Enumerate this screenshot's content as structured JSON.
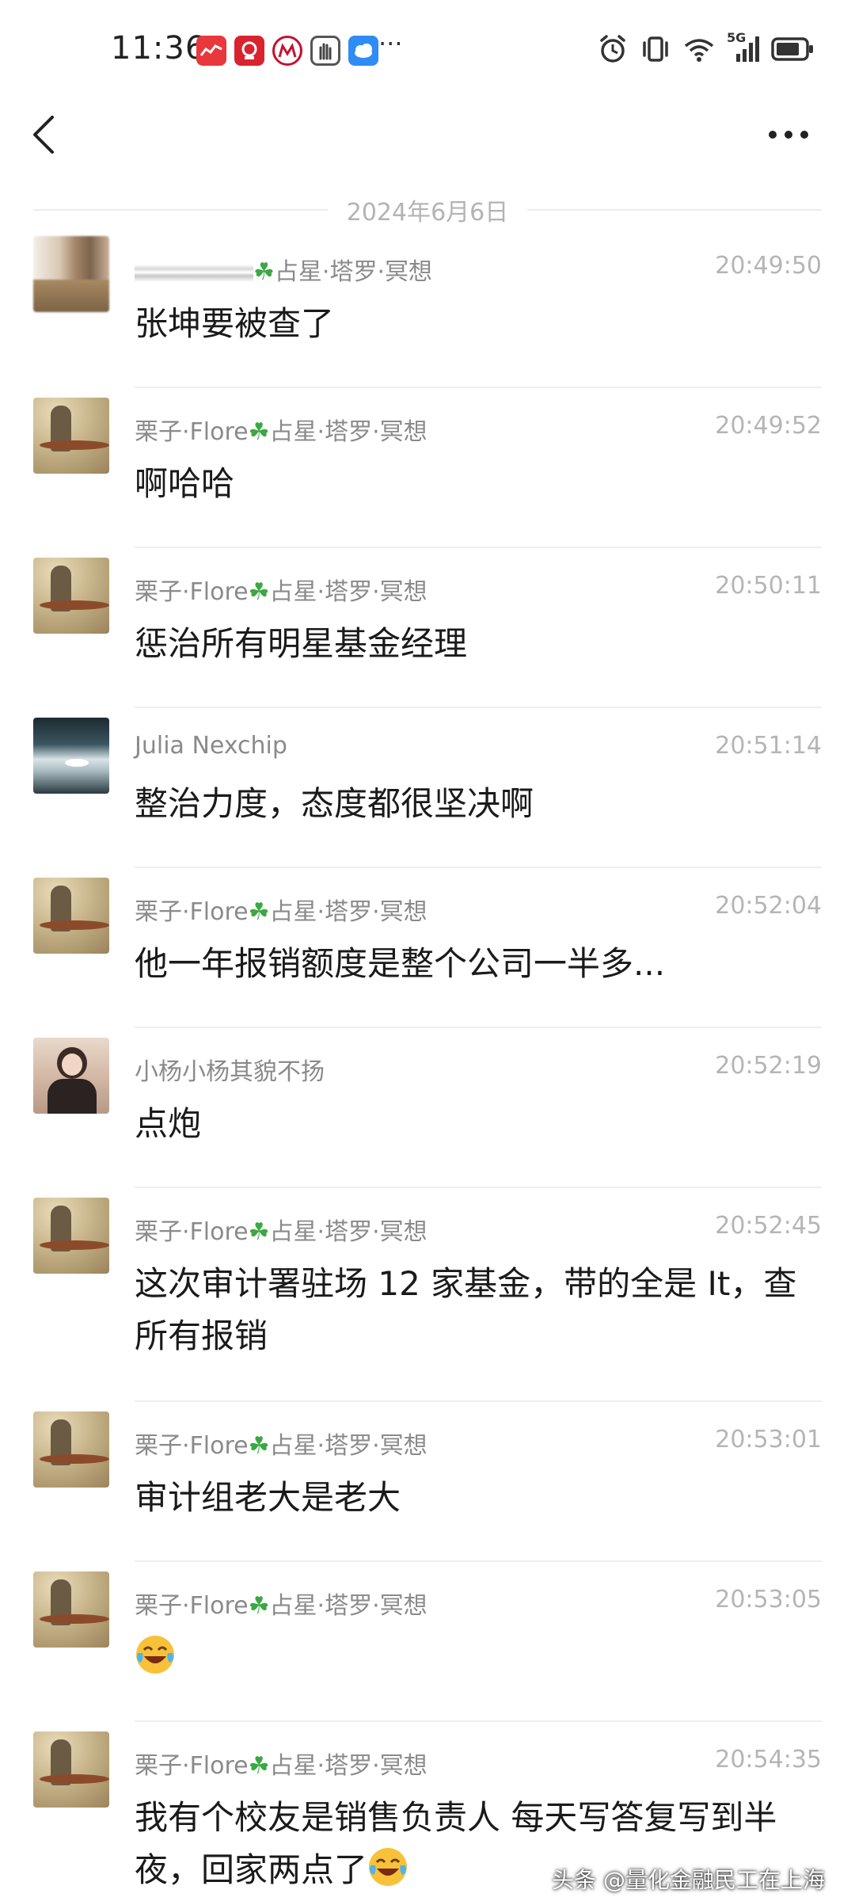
{
  "status_bar": {
    "time": "11:36",
    "more_dots": "···",
    "network": "5G",
    "icons": [
      "alarm-icon",
      "vibrate-icon",
      "wifi-icon",
      "signal-icon",
      "battery-icon"
    ],
    "app_icons": [
      "app-red-1-icon",
      "app-red-2-icon",
      "app-china-merchants-icon",
      "app-hand-icon",
      "app-weather-icon"
    ]
  },
  "header": {
    "back_icon": "chevron-left-icon",
    "more_icon": "more-horizontal-icon"
  },
  "date_separator": "2024年6月6日",
  "colors": {
    "name_gray": "#8a8a8a",
    "time_gray": "#b5b5b5",
    "clover_green": "#3aa843"
  },
  "messages": [
    {
      "name_prefix": "",
      "name_suffix": "占星·塔罗·冥想",
      "time": "20:49:50",
      "text": "张坤要被查了",
      "avatar": "blurred"
    },
    {
      "name_prefix": "栗子·Flore",
      "name_suffix": "占星·塔罗·冥想",
      "time": "20:49:52",
      "text": "啊哈哈",
      "avatar": "table"
    },
    {
      "name_prefix": "栗子·Flore",
      "name_suffix": "占星·塔罗·冥想",
      "time": "20:50:11",
      "text": "惩治所有明星基金经理",
      "avatar": "table"
    },
    {
      "name_prefix": "Julia Nexchip",
      "name_suffix": "",
      "time": "20:51:14",
      "text": "整治力度，态度都很坚决啊",
      "avatar": "water"
    },
    {
      "name_prefix": "栗子·Flore",
      "name_suffix": "占星·塔罗·冥想",
      "time": "20:52:04",
      "text": "他一年报销额度是整个公司一半多...",
      "avatar": "table"
    },
    {
      "name_prefix": "小杨小杨其貌不扬",
      "name_suffix": "",
      "time": "20:52:19",
      "text": "点炮",
      "avatar": "girl"
    },
    {
      "name_prefix": "栗子·Flore",
      "name_suffix": "占星·塔罗·冥想",
      "time": "20:52:45",
      "text": "这次审计署驻场 12 家基金，带的全是 It，查所有报销",
      "avatar": "table"
    },
    {
      "name_prefix": "栗子·Flore",
      "name_suffix": "占星·塔罗·冥想",
      "time": "20:53:01",
      "text": "审计组老大是老大",
      "avatar": "table"
    },
    {
      "name_prefix": "栗子·Flore",
      "name_suffix": "占星·塔罗·冥想",
      "time": "20:53:05",
      "text": "",
      "emoji": "laugh-cry-emoji",
      "avatar": "table"
    },
    {
      "name_prefix": "栗子·Flore",
      "name_suffix": "占星·塔罗·冥想",
      "time": "20:54:35",
      "text": "我有个校友是销售负责人 每天写答复写到半夜，回家两点了",
      "emoji": "laugh-cry-emoji",
      "avatar": "table"
    }
  ],
  "watermark": "头条 @量化金融民工在上海"
}
